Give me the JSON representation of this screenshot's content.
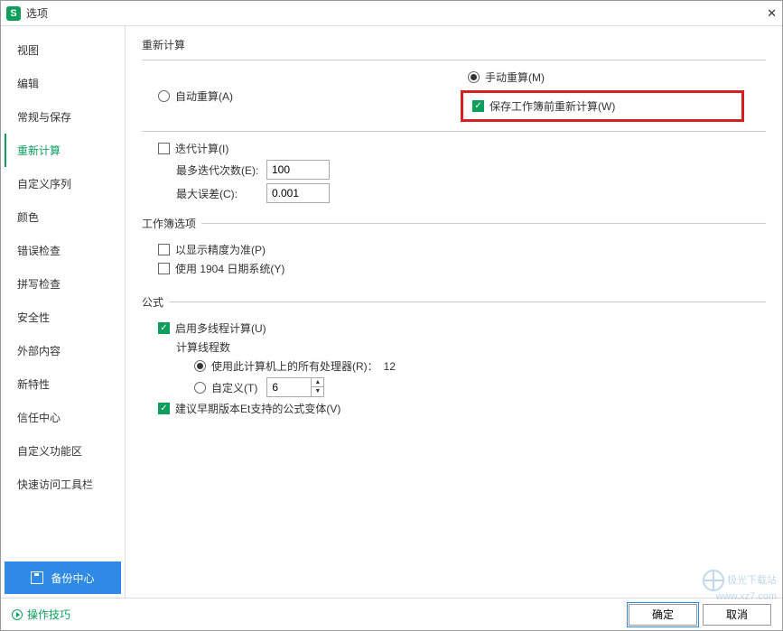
{
  "window": {
    "title": "选项"
  },
  "sidebar": {
    "items": [
      {
        "label": "视图"
      },
      {
        "label": "编辑"
      },
      {
        "label": "常规与保存"
      },
      {
        "label": "重新计算"
      },
      {
        "label": "自定义序列"
      },
      {
        "label": "颜色"
      },
      {
        "label": "错误检查"
      },
      {
        "label": "拼写检查"
      },
      {
        "label": "安全性"
      },
      {
        "label": "外部内容"
      },
      {
        "label": "新特性"
      },
      {
        "label": "信任中心"
      },
      {
        "label": "自定义功能区"
      },
      {
        "label": "快速访问工具栏"
      }
    ],
    "backup_button": "备份中心"
  },
  "main": {
    "recalc": {
      "title": "重新计算",
      "auto_label": "自动重算(A)",
      "manual_label": "手动重算(M)",
      "save_recalc_label": "保存工作簿前重新计算(W)",
      "iterative_label": "迭代计算(I)",
      "max_iter_label": "最多迭代次数(E):",
      "max_iter_value": "100",
      "max_diff_label": "最大误差(C):",
      "max_diff_value": "0.001"
    },
    "workbook": {
      "title": "工作簿选项",
      "precision_label": "以显示精度为准(P)",
      "date1904_label": "使用 1904 日期系统(Y)"
    },
    "formula": {
      "title": "公式",
      "multithread_label": "启用多线程计算(U)",
      "thread_count_label": "计算线程数",
      "use_all_label": "使用此计算机上的所有处理器(R)：",
      "use_all_value": "12",
      "custom_label": "自定义(T)",
      "custom_value": "6",
      "legacy_label": "建议早期版本Et支持的公式变体(V)"
    }
  },
  "footer": {
    "tips_label": "操作技巧",
    "ok_label": "确定",
    "cancel_label": "取消"
  },
  "watermark": {
    "line1": "极光下载站",
    "line2": "www.xz7.com"
  }
}
